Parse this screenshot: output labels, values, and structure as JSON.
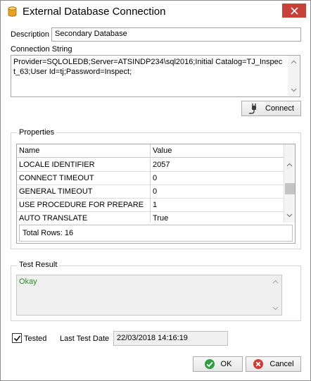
{
  "window": {
    "title": "External Database Connection",
    "icons": {
      "app": "database-icon",
      "close": "close-icon"
    },
    "colors": {
      "close_button": "#c7403a",
      "result_text": "#2e8b2e"
    }
  },
  "form": {
    "description_label": "Description",
    "description_value": "Secondary Database",
    "connection_string_label": "Connection String",
    "connection_string_value": "Provider=SQLOLEDB;Server=ATSINDP234\\sql2016;Initial Catalog=TJ_Inspect_63;User Id=tj;Password=Inspect;",
    "connect_label": "Connect",
    "connect_icon": "plug-icon"
  },
  "properties": {
    "group_title": "Properties",
    "columns": [
      "Name",
      "Value"
    ],
    "rows": [
      {
        "name": "LOCALE IDENTIFIER",
        "value": "2057"
      },
      {
        "name": "CONNECT TIMEOUT",
        "value": "0"
      },
      {
        "name": "GENERAL TIMEOUT",
        "value": "0"
      },
      {
        "name": "USE PROCEDURE FOR PREPARE",
        "value": "1"
      },
      {
        "name": "AUTO TRANSLATE",
        "value": "True"
      }
    ],
    "total_rows": "Total Rows: 16"
  },
  "test_result": {
    "group_title": "Test Result",
    "text": "Okay"
  },
  "footer": {
    "tested_label": "Tested",
    "tested_checked": true,
    "last_test_date_label": "Last Test Date",
    "last_test_date_value": "22/03/2018 14:16:19",
    "ok_label": "OK",
    "cancel_label": "Cancel",
    "ok_icon": "check-circle-icon",
    "cancel_icon": "cancel-circle-icon"
  }
}
